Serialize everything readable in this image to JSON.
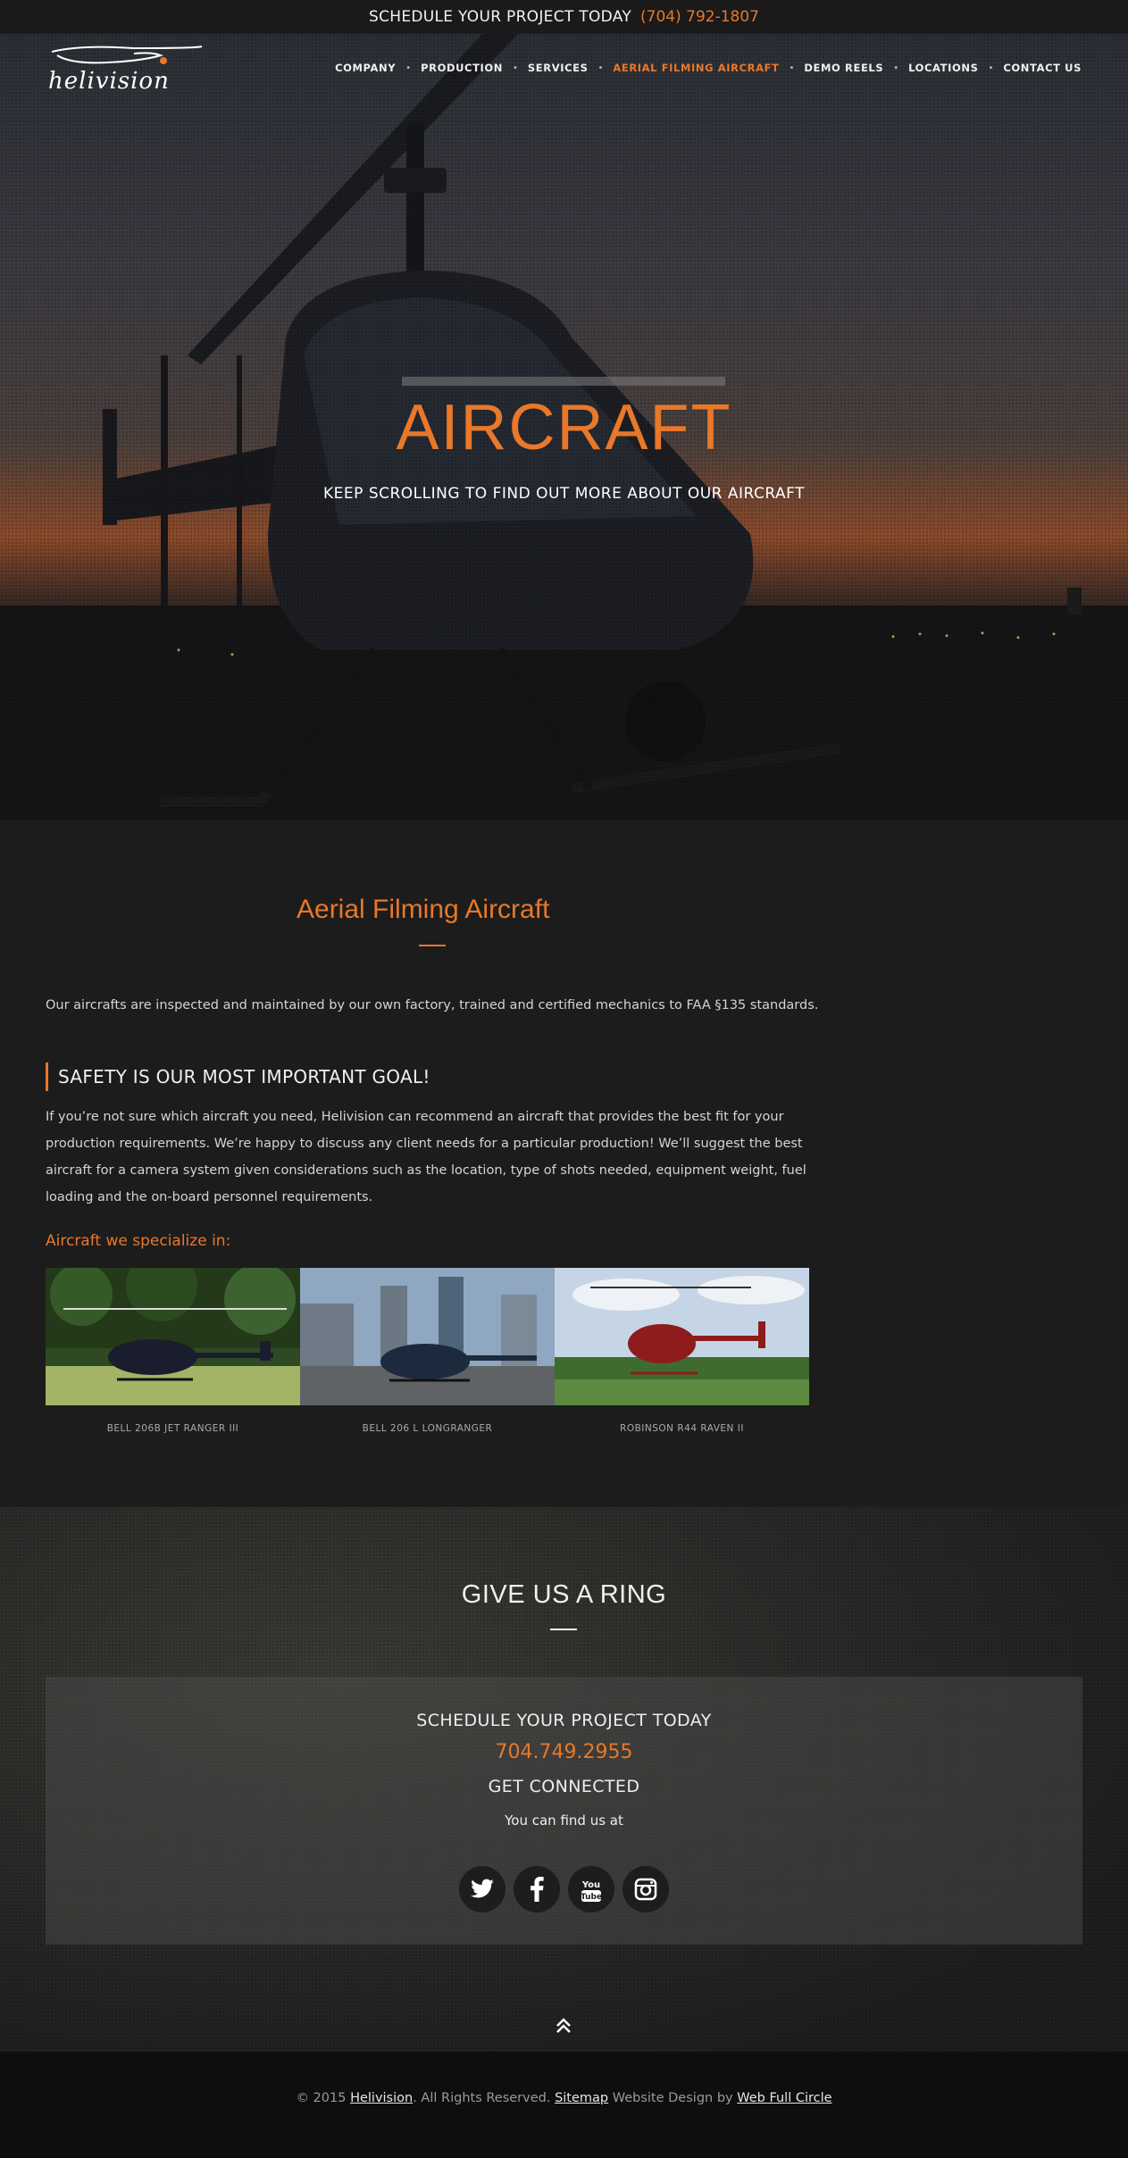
{
  "topbar": {
    "text": "SCHEDULE YOUR PROJECT TODAY",
    "phone": "(704) 792-1807"
  },
  "logo": {
    "text": "helivision"
  },
  "nav": {
    "items": [
      {
        "label": "COMPANY"
      },
      {
        "label": "PRODUCTION"
      },
      {
        "label": "SERVICES"
      },
      {
        "label": "AERIAL FILMING AIRCRAFT",
        "active": true
      },
      {
        "label": "DEMO REELS"
      },
      {
        "label": "LOCATIONS"
      },
      {
        "label": "CONTACT US"
      }
    ]
  },
  "hero": {
    "title": "AIRCRAFT",
    "subtitle": "KEEP SCROLLING TO FIND OUT MORE ABOUT OUR AIRCRAFT"
  },
  "content": {
    "heading": "Aerial Filming Aircraft",
    "intro": "Our aircrafts are inspected and maintained by our own factory, trained and certified mechanics to FAA §135 standards.",
    "goal": "SAFETY IS OUR MOST IMPORTANT GOAL!",
    "body": "If you’re not sure which aircraft you need, Helivision can recommend an aircraft that provides the best fit for your production requirements. We’re happy to discuss any client needs for a particular production! We’ll suggest the best aircraft for a camera system given considerations such as the location, type of shots needed, equipment weight, fuel loading and the on-board personnel requirements.",
    "specialize": "Aircraft we specialize in:",
    "aircraft": [
      {
        "caption": "BELL 206B JET RANGER III"
      },
      {
        "caption": "BELL 206 L LONGRANGER"
      },
      {
        "caption": "ROBINSON R44 RAVEN II"
      }
    ]
  },
  "ring": {
    "title": "GIVE US A RING",
    "schedule": "SCHEDULE YOUR PROJECT TODAY",
    "phone": "704.749.2955",
    "connected": "GET CONNECTED",
    "find": "You can find us at",
    "socials": [
      "twitter-icon",
      "facebook-icon",
      "youtube-icon",
      "instagram-icon"
    ]
  },
  "footer": {
    "prefix": "© 2015 ",
    "brand": "Helivision",
    "rights": ". All Rights Reserved. ",
    "sitemap": "Sitemap",
    "design": " Website Design by ",
    "designer": "Web Full Circle"
  },
  "colors": {
    "accent": "#e8782a",
    "background": "#1c1c1c"
  }
}
